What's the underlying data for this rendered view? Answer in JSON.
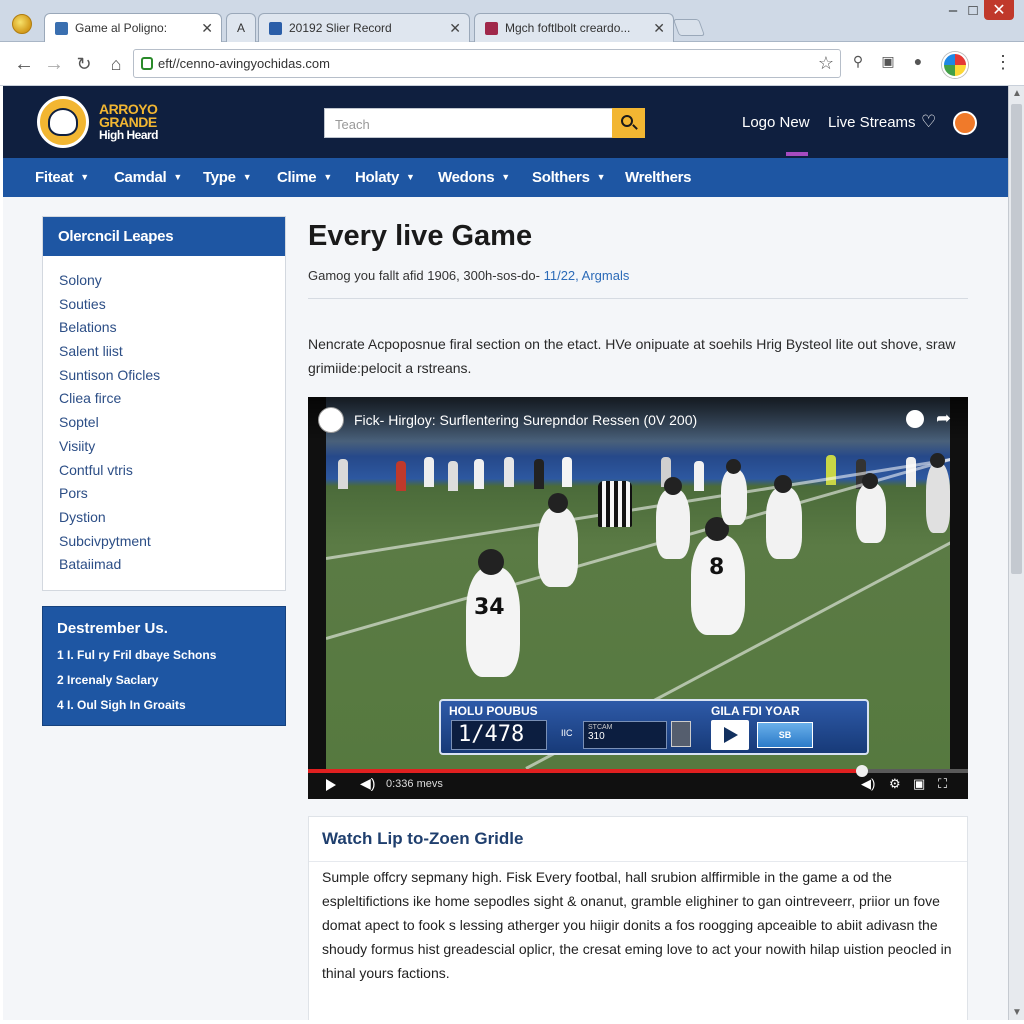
{
  "browser": {
    "tabs": [
      {
        "label": "Game al Poligno:",
        "active": true,
        "favicon_color": "#3a6fb0"
      },
      {
        "label": "A",
        "active": false,
        "favicon_color": "#888888"
      },
      {
        "label": "20192 Slier Record",
        "active": false,
        "favicon_color": "#2b5ea8"
      },
      {
        "label": "Mgch foftlbolt creardo...",
        "active": false,
        "favicon_color": "#a0284a"
      }
    ],
    "url": "eft//cenno-avingyochidas.com",
    "window_controls": {
      "minimize": "–",
      "maximize": "□",
      "close": "✕"
    }
  },
  "site": {
    "logo": {
      "line1": "ARROYO",
      "line2": "GRANDE",
      "line3": "High Heard"
    },
    "search_placeholder": "Teach",
    "header_links": [
      "Logo New",
      "Live Streams"
    ],
    "nav": [
      {
        "label": "Fiteat",
        "caret": true
      },
      {
        "label": "Camdal",
        "caret": true
      },
      {
        "label": "Type",
        "caret": true
      },
      {
        "label": "Clime",
        "caret": true
      },
      {
        "label": "Holaty",
        "caret": true
      },
      {
        "label": "Wedons",
        "caret": true
      },
      {
        "label": "Solthers",
        "caret": true
      },
      {
        "label": "Wrelthers",
        "caret": false
      }
    ]
  },
  "sidebar": {
    "title": "Olercncil Leapes",
    "items": [
      "Solony",
      "Souties",
      "Belations",
      "Salent liist",
      "Suntison Oficles",
      "Cliea firce",
      "Soptel",
      "Visiity",
      "Contful vtris",
      "Pors",
      "Dystion",
      "Subcivpytment",
      "Bataiimad"
    ],
    "box2_title": "Destrember Us.",
    "box2_items": [
      "1 I. Ful ry Fril dbaye Schons",
      "2 Ircenaly Saclary",
      "4 I. Oul Sigh In Groaits"
    ]
  },
  "content": {
    "title": "Every live Game",
    "subtitle_prefix": "Gamog you fallt afid 1906, 300h-sos-do- ",
    "subtitle_link": "11/22, Argmals",
    "intro": "Nencrate Acpoposnue firal section on the etact. HVe onipuate at soehils Hrig Bysteol lite out shove, sraw grimiide:pelocit a rstreans.",
    "lower_title": "Watch Lip to-Zoen Gridle",
    "lower_body": "Sumple offcry sepmany high. Fisk Every footbal, hall srubion alffirmible in the game a od the espleltifictions ike home sepodles sight & onanut, gramble elighiner to gan ointreveerr, priior un fove domat apect to fook s lessing atherger you hiigir donits a fos roogging apceaible to abiit adivasn the shoudy formus hist greadescial oplicr, the cresat eming love to act your nowith hilap uistion peocled in thinal yours factions."
  },
  "video": {
    "title": "Fick- Hirgloy: Surflentering Surepndor Ressen (0V 200)",
    "progress": 0.84,
    "time": "0:336 mevs",
    "scorebug": {
      "team_left": "HOLU POUBUS",
      "team_right": "GILA FDI YOAR",
      "score": "1/478",
      "quarter": "IIC",
      "clock_label": "STCAM",
      "clock_value": "310",
      "logo_text": "SB"
    },
    "jersey_numbers": [
      "34",
      "8"
    ]
  },
  "colors": {
    "header_bg": "#0f1f3f",
    "nav_bg": "#1e56a3",
    "accent": "#f2b632",
    "progress_red": "#e02020",
    "link": "#2c6bb8"
  }
}
